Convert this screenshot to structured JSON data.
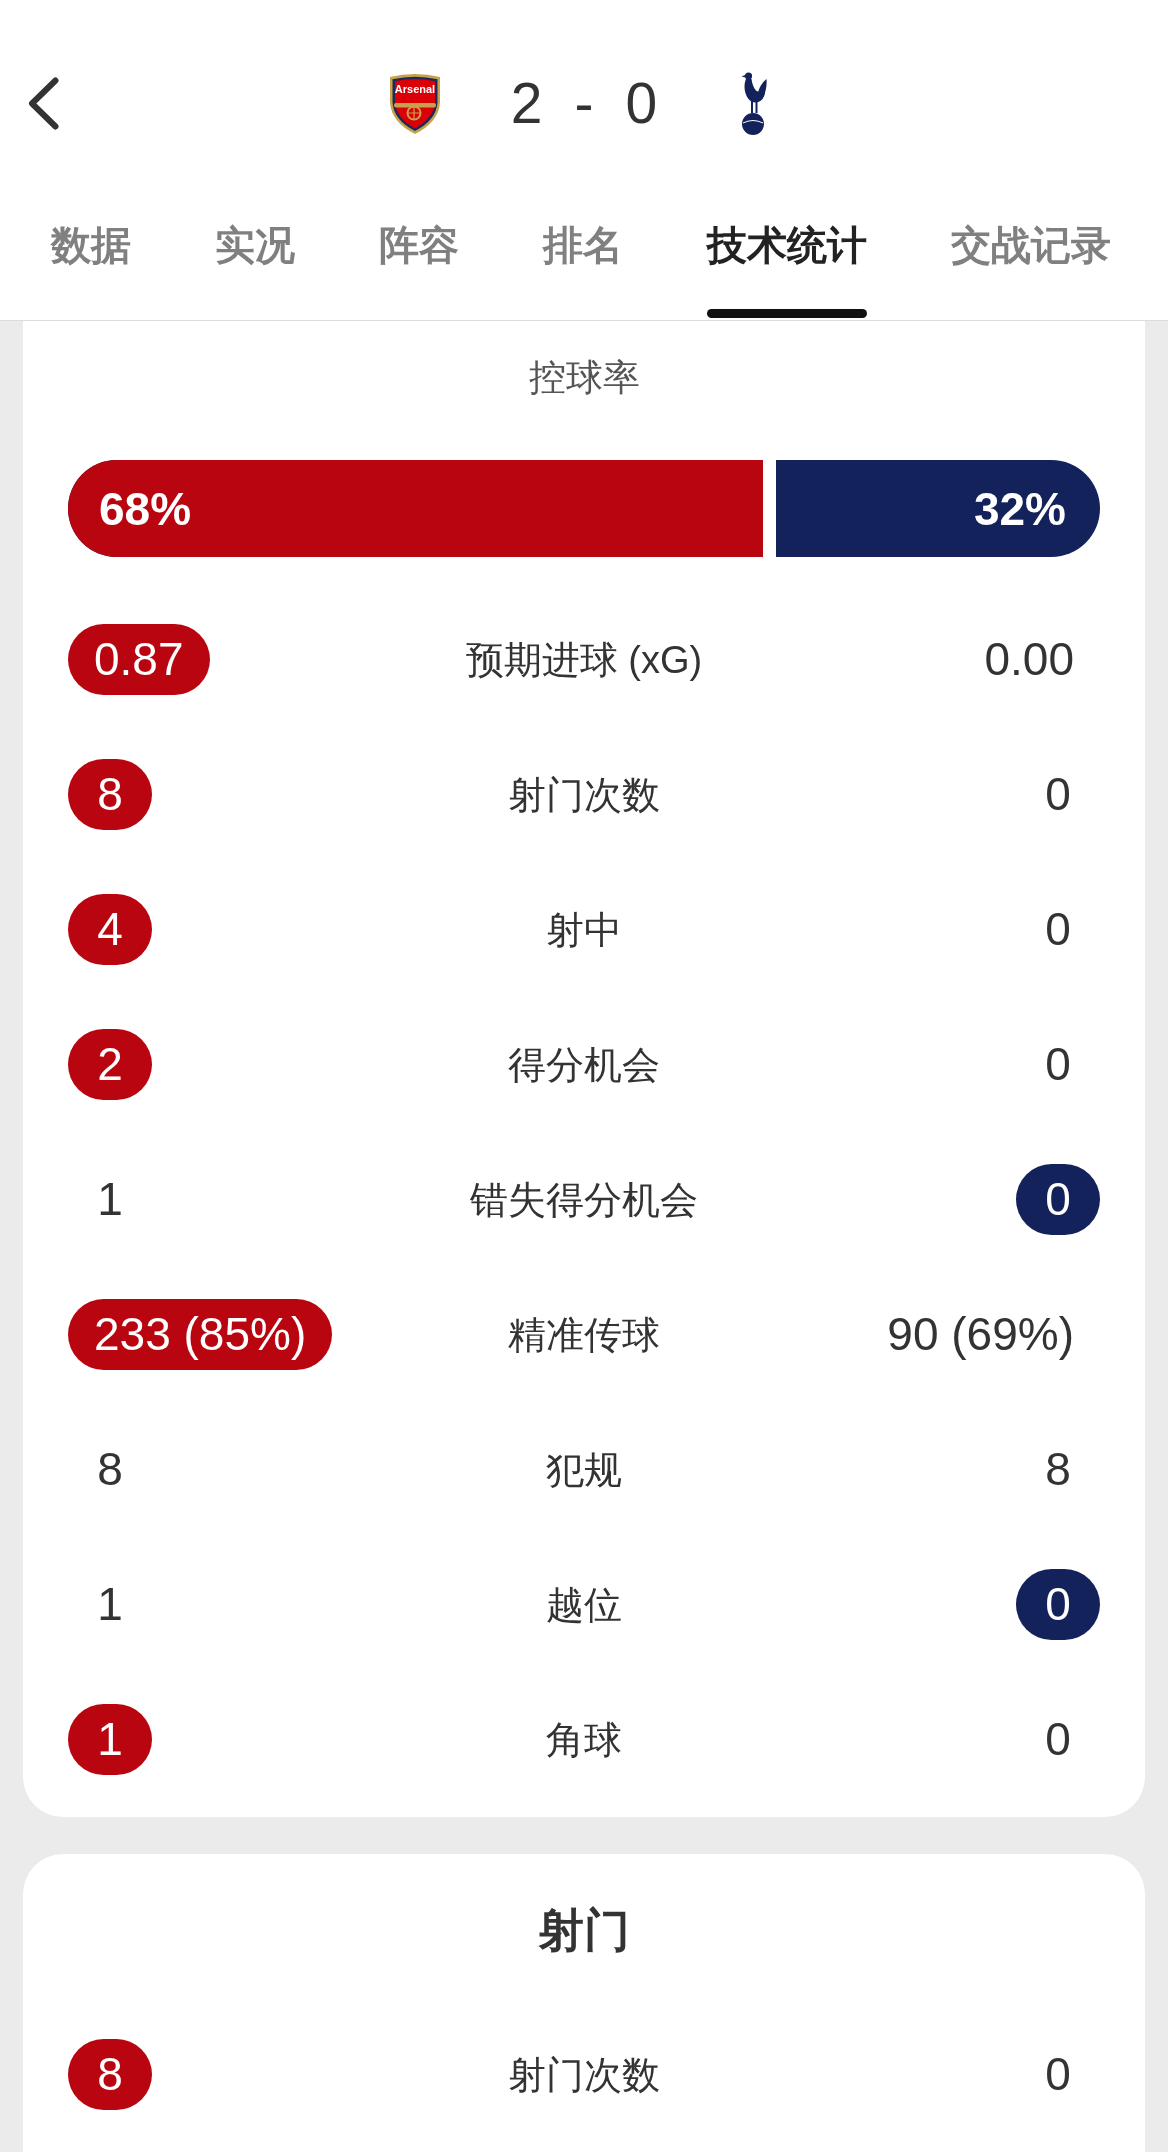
{
  "home_team": {
    "crest_text": "Arsenal",
    "color": "#b8050f"
  },
  "away_team": {
    "color": "#13225a"
  },
  "score": {
    "home": "2",
    "separator": "-",
    "away": "0"
  },
  "tabs": [
    {
      "label": "数据",
      "selected": false
    },
    {
      "label": "实况",
      "selected": false
    },
    {
      "label": "阵容",
      "selected": false
    },
    {
      "label": "排名",
      "selected": false
    },
    {
      "label": "技术统计",
      "selected": true
    },
    {
      "label": "交战记录",
      "selected": false
    }
  ],
  "possession": {
    "title": "控球率",
    "level": 0.68,
    "home_value": "68%",
    "away_value": "32%"
  },
  "stats": [
    {
      "label": "预期进球 (xG)",
      "home": {
        "value": "0.87",
        "highlighted": true
      },
      "away": {
        "value": "0.00",
        "highlighted": false
      }
    },
    {
      "label": "射门次数",
      "home": {
        "value": "8",
        "highlighted": true
      },
      "away": {
        "value": "0",
        "highlighted": false
      }
    },
    {
      "label": "射中",
      "home": {
        "value": "4",
        "highlighted": true
      },
      "away": {
        "value": "0",
        "highlighted": false
      }
    },
    {
      "label": "得分机会",
      "home": {
        "value": "2",
        "highlighted": true
      },
      "away": {
        "value": "0",
        "highlighted": false
      }
    },
    {
      "label": "错失得分机会",
      "home": {
        "value": "1",
        "highlighted": false
      },
      "away": {
        "value": "0",
        "highlighted": true
      }
    },
    {
      "label": "精准传球",
      "home": {
        "value": "233 (85%)",
        "highlighted": true
      },
      "away": {
        "value": "90 (69%)",
        "highlighted": false
      }
    },
    {
      "label": "犯规",
      "home": {
        "value": "8",
        "highlighted": false
      },
      "away": {
        "value": "8",
        "highlighted": false
      }
    },
    {
      "label": "越位",
      "home": {
        "value": "1",
        "highlighted": false
      },
      "away": {
        "value": "0",
        "highlighted": true
      }
    },
    {
      "label": "角球",
      "home": {
        "value": "1",
        "highlighted": true
      },
      "away": {
        "value": "0",
        "highlighted": false
      }
    }
  ],
  "shots": {
    "title": "射门",
    "stats": [
      {
        "label": "射门次数",
        "home": {
          "value": "8",
          "highlighted": true
        },
        "away": {
          "value": "0",
          "highlighted": false
        }
      }
    ]
  }
}
